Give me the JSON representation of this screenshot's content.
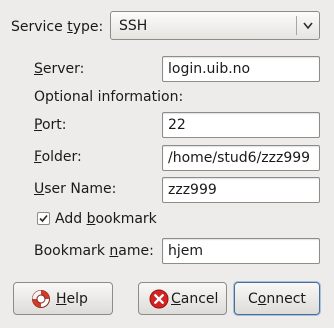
{
  "service_type": {
    "label_pre": "Service ",
    "label_mnemonic": "t",
    "label_post": "ype:",
    "selected": "SSH"
  },
  "server": {
    "label_mnemonic": "S",
    "label_rest": "erver:",
    "value": "login.uib.no"
  },
  "optional_heading": "Optional information:",
  "port": {
    "label_mnemonic": "P",
    "label_rest": "ort:",
    "value": "22"
  },
  "folder": {
    "label_mnemonic": "F",
    "label_rest": "older:",
    "value": "/home/stud6/zzz999"
  },
  "user_name": {
    "label_mnemonic": "U",
    "label_rest": "ser Name:",
    "value": "zzz999"
  },
  "add_bookmark": {
    "checked": true,
    "label_pre": "Add ",
    "label_mnemonic": "b",
    "label_post": "ookmark"
  },
  "bookmark_name": {
    "label_pre": "Bookmark ",
    "label_mnemonic": "n",
    "label_post": "ame:",
    "value": "hjem"
  },
  "buttons": {
    "help": {
      "mnemonic": "H",
      "rest": "elp",
      "icon": "lifebuoy-icon"
    },
    "cancel": {
      "mnemonic": "C",
      "rest": "ancel",
      "icon": "cancel-icon"
    },
    "connect": {
      "pre": "C",
      "mnemonic": "o",
      "rest": "nnect"
    }
  },
  "colors": {
    "background": "#edeceb",
    "cancel_icon": "#d42323",
    "help_icon": "#d23a2a",
    "default_button_border": "#4a6e9a"
  }
}
